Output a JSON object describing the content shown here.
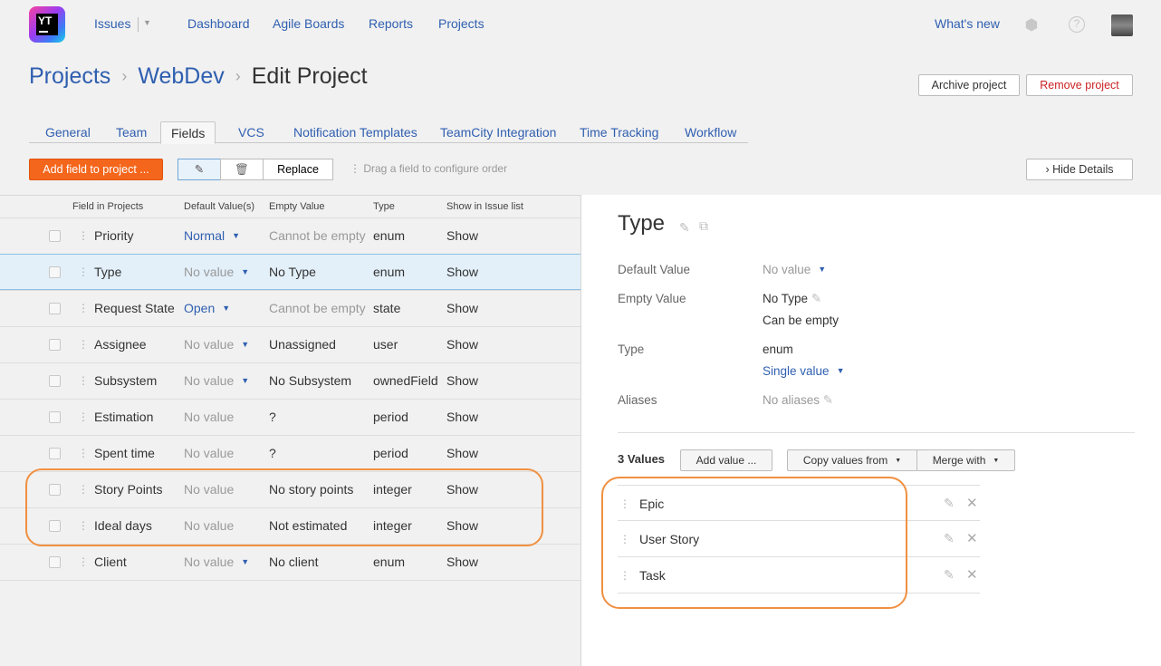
{
  "nav": {
    "logo_text": "YT",
    "issues": "Issues",
    "dashboard": "Dashboard",
    "agile_boards": "Agile Boards",
    "reports": "Reports",
    "projects": "Projects",
    "whats_new": "What's new",
    "help": "?"
  },
  "breadcrumb": {
    "projects": "Projects",
    "webdev": "WebDev",
    "current": "Edit Project",
    "sep": "›"
  },
  "header_buttons": {
    "archive": "Archive project",
    "remove": "Remove project"
  },
  "tabs": [
    "General",
    "Team",
    "Fields",
    "VCS",
    "Notification Templates",
    "TeamCity Integration",
    "Time Tracking",
    "Workflow"
  ],
  "active_tab": "Fields",
  "toolbar": {
    "add_field": "Add field to project ...",
    "replace": "Replace",
    "hint": "Drag a field to configure order",
    "hide_details": "Hide Details"
  },
  "table": {
    "headers": {
      "field": "Field in Projects",
      "default": "Default Value(s)",
      "empty": "Empty Value",
      "type": "Type",
      "show": "Show in Issue list"
    },
    "rows": [
      {
        "field": "Priority",
        "default": "Normal",
        "empty": "Cannot be empty",
        "type": "enum",
        "show": "Show"
      },
      {
        "field": "Type",
        "default": "No value",
        "empty": "No Type",
        "type": "enum",
        "show": "Show"
      },
      {
        "field": "Request State",
        "default": "Open",
        "empty": "Cannot be empty",
        "type": "state",
        "show": "Show"
      },
      {
        "field": "Assignee",
        "default": "No value",
        "empty": "Unassigned",
        "type": "user",
        "show": "Show"
      },
      {
        "field": "Subsystem",
        "default": "No value",
        "empty": "No Subsystem",
        "type": "ownedField",
        "show": "Show"
      },
      {
        "field": "Estimation",
        "default": "No value",
        "empty": "?",
        "type": "period",
        "show": "Show"
      },
      {
        "field": "Spent time",
        "default": "No value",
        "empty": "?",
        "type": "period",
        "show": "Show"
      },
      {
        "field": "Story Points",
        "default": "No value",
        "empty": "No story points",
        "type": "integer",
        "show": "Show"
      },
      {
        "field": "Ideal days",
        "default": "No value",
        "empty": "Not estimated",
        "type": "integer",
        "show": "Show"
      },
      {
        "field": "Client",
        "default": "No value",
        "empty": "No client",
        "type": "enum",
        "show": "Show"
      }
    ]
  },
  "details": {
    "title": "Type",
    "default_value_label": "Default Value",
    "default_value": "No value",
    "empty_value_label": "Empty Value",
    "empty_value": "No Type",
    "empty_value_note": "Can be empty",
    "type_label": "Type",
    "type_value": "enum",
    "cardinality": "Single value",
    "aliases_label": "Aliases",
    "aliases_value": "No aliases",
    "values_count": "3 Values",
    "add_value": "Add value ...",
    "copy_values": "Copy values from",
    "merge_with": "Merge with",
    "values": [
      "Epic",
      "User Story",
      "Task"
    ]
  },
  "colors": {
    "accent": "#f4661b",
    "link": "#2f5fb0",
    "highlight": "#f09040",
    "selected_row": "#e3f0fa"
  }
}
